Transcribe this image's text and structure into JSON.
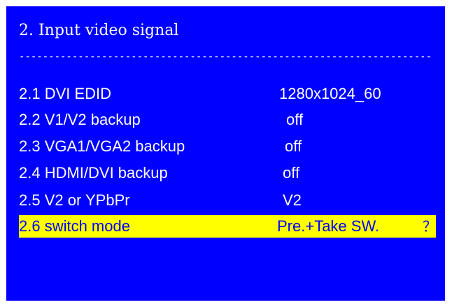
{
  "screen": {
    "title": "2. Input video signal",
    "divider": "----------------------------------------------------------------------",
    "background_color": "#0000ff",
    "text_color": "#ffffff",
    "highlight_color": "#ffff00",
    "items": [
      {
        "label": "2.1 DVI EDID",
        "value": "1280x1024_60"
      },
      {
        "label": "2.2 V1/V2 backup",
        "value": "off"
      },
      {
        "label": "2.3 VGA1/VGA2 backup",
        "value": "off"
      },
      {
        "label": "2.4 HDMI/DVI backup",
        "value": "off"
      },
      {
        "label": "2.5 V2 or YPbPr",
        "value": "V2"
      },
      {
        "label": "2.6 switch mode",
        "value": "Pre.+Take SW.",
        "suffix": "？",
        "selected": true
      }
    ]
  }
}
